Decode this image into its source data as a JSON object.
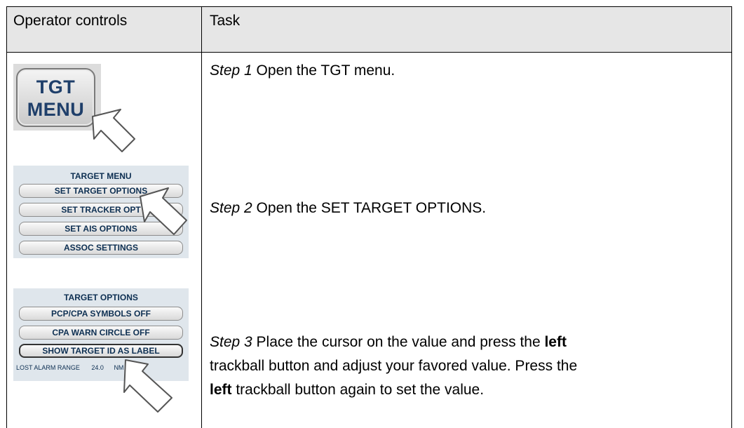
{
  "header": {
    "col1": "Operator controls",
    "col2": "Task"
  },
  "tgt_button": {
    "line1": "TGT",
    "line2": "MENU"
  },
  "target_menu": {
    "title": "TARGET MENU",
    "items": [
      "SET TARGET OPTIONS",
      "SET TRACKER OPT",
      "SET AIS OPTIONS",
      "ASSOC SETTINGS"
    ]
  },
  "target_options": {
    "title": "TARGET OPTIONS",
    "items": [
      "PCP/CPA SYMBOLS OFF",
      "CPA WARN CIRCLE OFF",
      "SHOW TARGET ID AS LABEL"
    ],
    "lost_label": "LOST ALARM RANGE",
    "lost_value": "24.0",
    "lost_unit": "NM"
  },
  "steps": {
    "step1": {
      "label": "Step 1",
      "text": " Open the TGT menu."
    },
    "step2": {
      "label": "Step 2",
      "text": " Open the SET TARGET OPTIONS."
    },
    "step3": {
      "label": "Step 3",
      "l1a": " Place the cursor on the value and press the ",
      "bold1": "left",
      "l2": "trackball button and adjust your favored value. Press the",
      "bold2": "left",
      "l3b": " trackball button again to set the value."
    }
  },
  "colors": {
    "header_bg": "#e6e6e6",
    "button_text": "#1f3f6a",
    "panel_bg": "#dfe6ec"
  }
}
